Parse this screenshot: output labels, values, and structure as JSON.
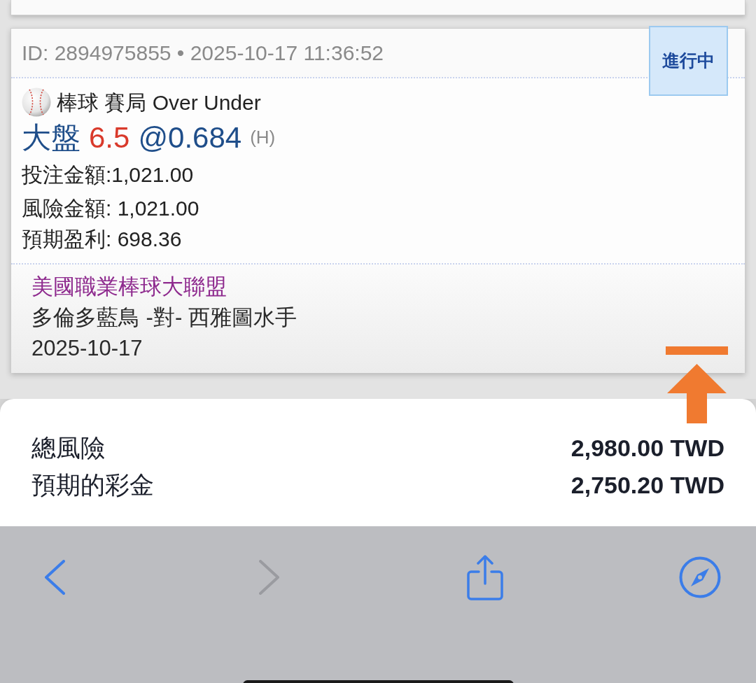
{
  "bet": {
    "header": "ID: 2894975855 • 2025-10-17 11:36:52",
    "status": "進行中",
    "market": "棒球 賽局 Over Under",
    "selection": {
      "side": "大盤",
      "line": "6.5",
      "odds": "@0.684",
      "tag": "(H)"
    },
    "details": [
      "投注金額:1,021.00",
      "風險金額: 1,021.00",
      "預期盈利: 698.36"
    ],
    "league": "美國職業棒球大聯盟",
    "match": "多倫多藍鳥 -對- 西雅圖水手",
    "date": "2025-10-17"
  },
  "summary": [
    {
      "label": "總風險",
      "value": "2,980.00 TWD"
    },
    {
      "label": "預期的彩金",
      "value": "2,750.20 TWD"
    }
  ],
  "toolbar": [
    {
      "kind": "back",
      "disabled": false
    },
    {
      "kind": "forward",
      "disabled": true
    },
    {
      "kind": "share",
      "disabled": false
    },
    {
      "kind": "compass",
      "disabled": false
    }
  ]
}
